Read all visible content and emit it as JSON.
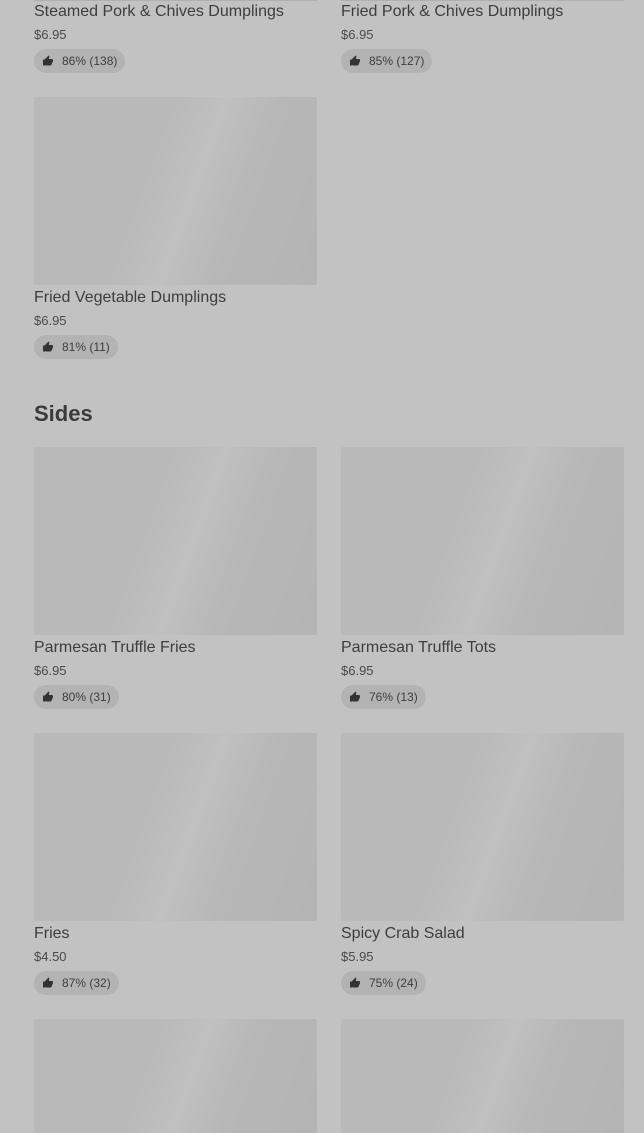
{
  "top_items": [
    {
      "name": "Steamed Pork & Chives Dumplings",
      "price": "$6.95",
      "rating": "86% (138)"
    },
    {
      "name": "Fried Pork & Chives Dumplings",
      "price": "$6.95",
      "rating": "85% (127)"
    },
    {
      "name": "Fried Vegetable Dumplings",
      "price": "$6.95",
      "rating": "81% (11)"
    }
  ],
  "sides": {
    "title": "Sides",
    "items": [
      {
        "name": "Parmesan Truffle Fries",
        "price": "$6.95",
        "rating": "80% (31)"
      },
      {
        "name": "Parmesan Truffle Tots",
        "price": "$6.95",
        "rating": "76% (13)"
      },
      {
        "name": "Fries",
        "price": "$4.50",
        "rating": "87% (32)"
      },
      {
        "name": "Spicy Crab Salad",
        "price": "$5.95",
        "rating": "75% (24)"
      }
    ]
  },
  "icons": {
    "rating": "thumbs-up-icon"
  }
}
